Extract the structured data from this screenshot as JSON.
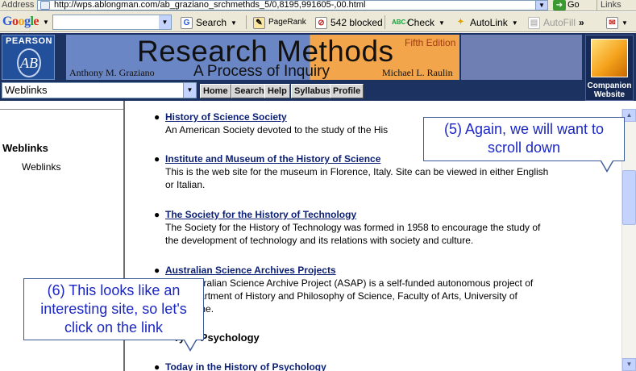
{
  "browser": {
    "address_label": "Address",
    "url": "http://wps.ablongman.com/ab_graziano_srchmethds_5/0,8195,991605-,00.html",
    "go_label": "Go",
    "links_label": "Links"
  },
  "google_toolbar": {
    "logo": "Google",
    "search_label": "Search",
    "pagerank_label": "PageRank",
    "blocked_label": "542 blocked",
    "check_label": "Check",
    "autolink_label": "AutoLink",
    "autofill_label": "AutoFill",
    "more_label": "»"
  },
  "banner": {
    "publisher": "PEARSON",
    "seal": "AB",
    "title": "Research Methods",
    "subtitle": "A Process of Inquiry",
    "edition": "Fifth Edition",
    "author_left": "Anthony M. Graziano",
    "author_right": "Michael L. Raulin",
    "companion_line1": "Companion",
    "companion_line2": "Website"
  },
  "nav": {
    "section_select": "Weblinks",
    "buttons": [
      "Home",
      "Search",
      "Help",
      "Syllabus",
      "Profile"
    ]
  },
  "sidebar": {
    "heading": "Weblinks",
    "items": [
      "Weblinks"
    ]
  },
  "content": {
    "entries": [
      {
        "title": "History of Science Society",
        "desc": "An American Society devoted to the study of the His"
      },
      {
        "title": "Institute and Museum of the History of Science",
        "desc": "This is the web site for the museum in Florence, Italy. Site can be viewed in either English or Italian."
      },
      {
        "title": "The Society for the History of Technology",
        "desc": "The Society for the History of Technology was formed in 1958 to encourage the study of the development of technology and its relations with society and culture."
      },
      {
        "title": "Australian Science Archives Projects",
        "desc": "The Australian Science Archive Project (ASAP) is a self-funded autonomous project of the Department of History and Philosophy of Science, Faculty of Arts, University of Melbourne."
      },
      {
        "title": "Today in the History of Psychology",
        "desc": ""
      }
    ],
    "section_heading": "ry of Psychology"
  },
  "callouts": {
    "step5": "(5) Again, we will want to scroll down",
    "step6": "(6) This looks like an interesting site, so let's click on the link"
  },
  "icons": {
    "page": "page-icon",
    "go": "go-arrow-icon",
    "pagerank": "pagerank-icon",
    "popup_blocker": "popup-blocker-icon",
    "spellcheck": "spellcheck-icon",
    "autolink": "autolink-icon",
    "autofill": "autofill-icon"
  }
}
